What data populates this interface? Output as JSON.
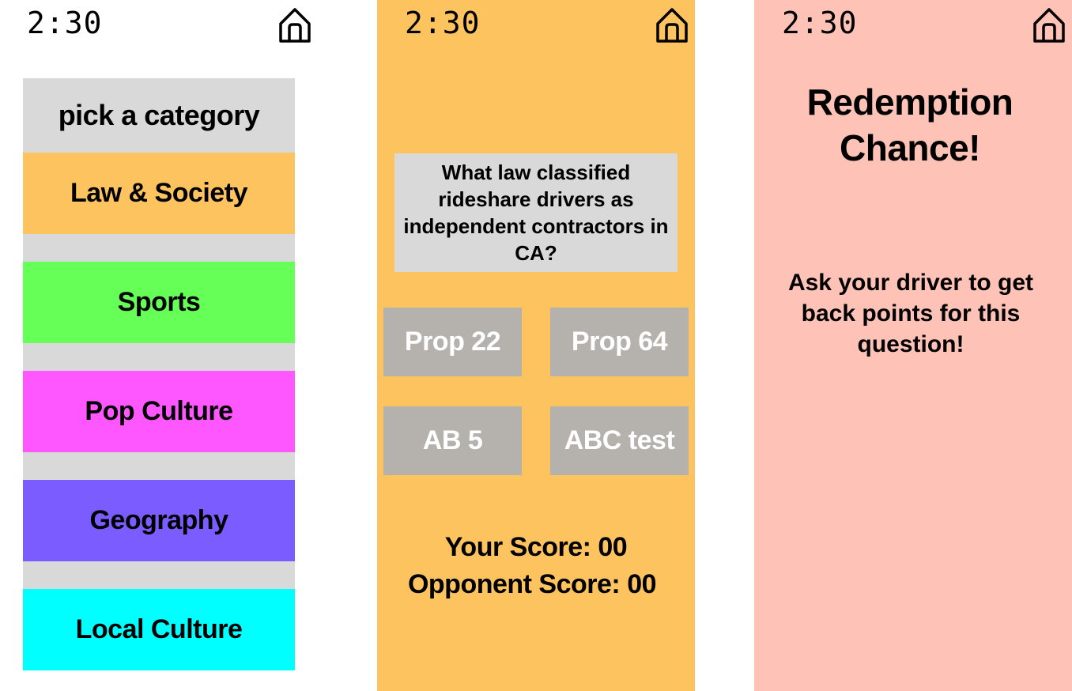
{
  "clock": {
    "time": "2:30"
  },
  "icons": {
    "home": "home-icon"
  },
  "category_screen": {
    "title": "pick a category",
    "categories": [
      {
        "label": "Law & Society",
        "color": "#fcc35e"
      },
      {
        "label": "Sports",
        "color": "#66ff57"
      },
      {
        "label": "Pop Culture",
        "color": "#ff57ff"
      },
      {
        "label": "Geography",
        "color": "#7a5cff"
      },
      {
        "label": "Local Culture",
        "color": "#00ffff"
      }
    ],
    "list_background": "#d9d9d9"
  },
  "question_screen": {
    "background": "#fcc35e",
    "question": "What law classified rideshare drivers as independent contractors in CA?",
    "answers": [
      "Prop 22",
      "Prop 64",
      "AB 5",
      "ABC test"
    ],
    "your_score": "Your Score: 00",
    "opponent_score": "Opponent Score: 00"
  },
  "redemption_screen": {
    "background": "#fec2b6",
    "title": "Redemption Chance!",
    "message": "Ask your driver to get back points for this question!"
  }
}
